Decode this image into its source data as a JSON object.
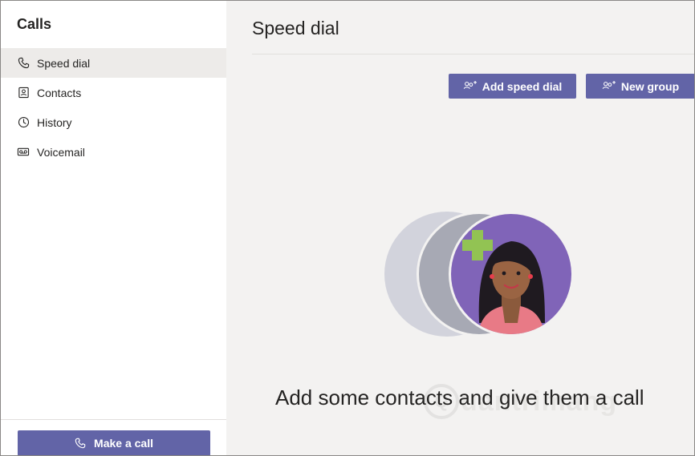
{
  "sidebar": {
    "title": "Calls",
    "items": [
      {
        "label": "Speed dial",
        "icon": "phone-icon",
        "active": true
      },
      {
        "label": "Contacts",
        "icon": "contact-card-icon",
        "active": false
      },
      {
        "label": "History",
        "icon": "clock-icon",
        "active": false
      },
      {
        "label": "Voicemail",
        "icon": "voicemail-icon",
        "active": false
      }
    ],
    "make_call_label": "Make a call"
  },
  "main": {
    "title": "Speed dial",
    "buttons": {
      "add_speed_dial": "Add speed dial",
      "new_group": "New group"
    },
    "empty_state_text": "Add some contacts and give them a call",
    "watermark_text": "uantrimang",
    "watermark_letter": "Q"
  },
  "colors": {
    "brand": "#6264a7",
    "sidebar_bg": "#ffffff",
    "main_bg": "#f3f2f1",
    "active_item_bg": "#edebe9",
    "illustration_purple": "#8064b8",
    "plus_green": "#92c353"
  }
}
